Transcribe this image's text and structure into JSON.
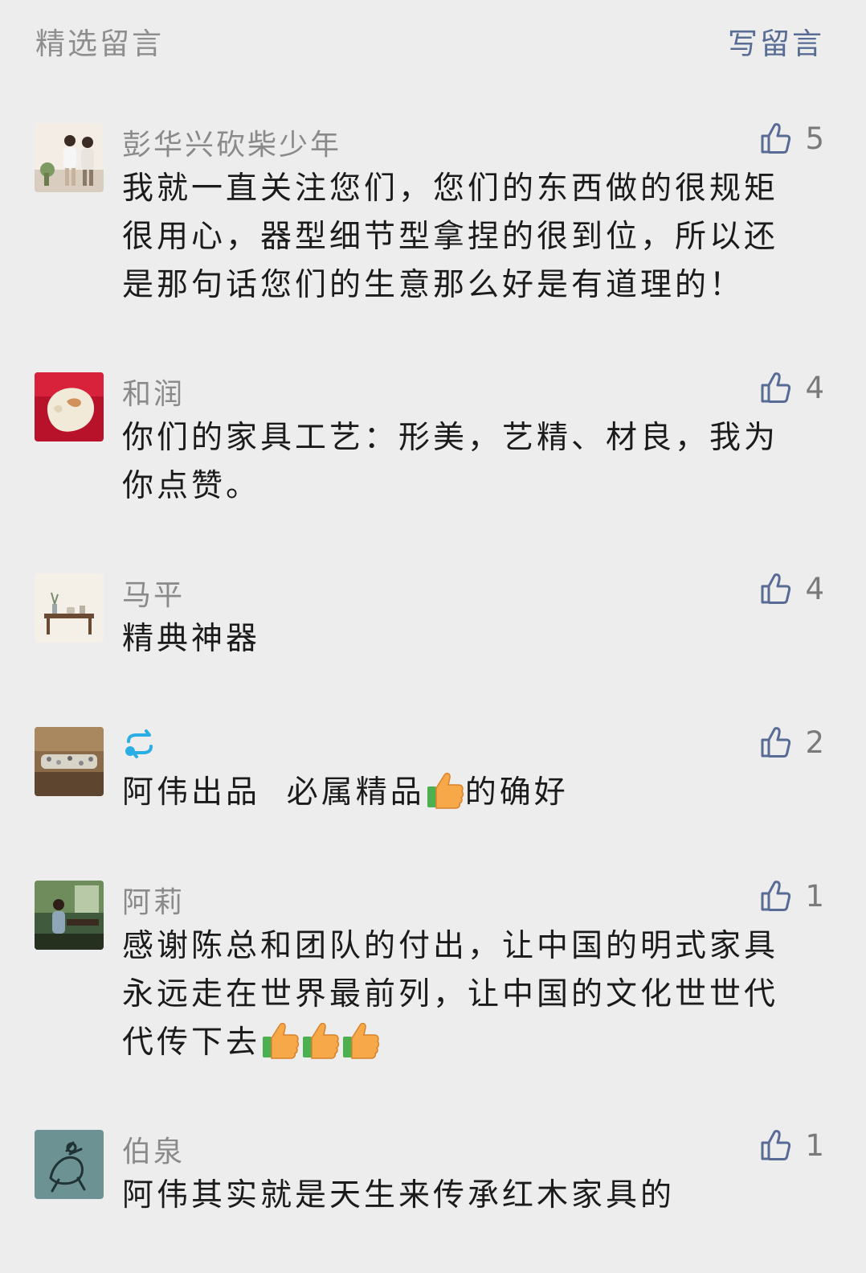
{
  "header": {
    "title": "精选留言",
    "write_label": "写留言"
  },
  "comments": [
    {
      "nickname": "彭华兴砍柴少年",
      "likes": "5",
      "text": "我就一直关注您们，您们的东西做的很规矩很用心，器型细节型拿捏的很到位，所以还是那句话您们的生意那么好是有道理的！"
    },
    {
      "nickname": "和润",
      "likes": "4",
      "text": "你们的家具工艺：形美，艺精、材良，我为你点赞。"
    },
    {
      "nickname": "马平",
      "likes": "4",
      "text": "精典神器"
    },
    {
      "nickname": "",
      "likes": "2",
      "text_before": "阿伟出品  必属精品",
      "text_after": "的确好"
    },
    {
      "nickname": "阿莉",
      "likes": "1",
      "text": "感谢陈总和团队的付出，让中国的明式家具永远走在世界最前列，让中国的文化世世代代传下去"
    },
    {
      "nickname": "伯泉",
      "likes": "1",
      "text": "阿伟其实就是天生来传承红木家具的"
    }
  ],
  "colors": {
    "background": "#ededed",
    "nickname": "#8a8a8a",
    "link": "#586c94",
    "text": "#1b1b1b",
    "repost_icon": "#2aaee4"
  },
  "icons": [
    "thumb-up-icon",
    "thumbs-up-emoji-icon",
    "repost-icon"
  ]
}
